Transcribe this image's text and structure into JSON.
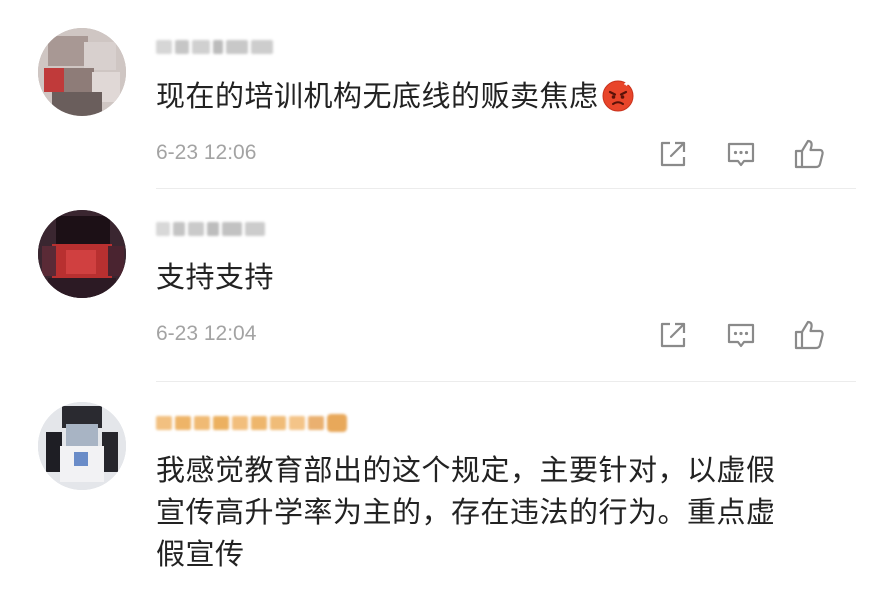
{
  "comments": [
    {
      "text": "现在的培训机构无底线的贩卖焦虑",
      "emoji": "angry-face-emoji",
      "time": "6-23 12:06",
      "username_color": "#c4c4c4"
    },
    {
      "text": "支持支持",
      "time": "6-23 12:04",
      "username_color": "#c4c4c4"
    },
    {
      "text_lines": [
        "我感觉教育部出的这个规定，主要针对，以虚假",
        "宣传高升学率为主的，存在违法的行为。重点虚",
        "假宣传"
      ],
      "username_color": "#f0b060"
    }
  ],
  "icons": {
    "share": "share-icon",
    "reply": "comment-icon",
    "like": "thumbs-up-icon"
  },
  "colors": {
    "text": "#222222",
    "timestamp": "#a3a3a3",
    "icon": "#8a8a8a",
    "divider": "#ececec",
    "emoji_red": "#e8452a"
  }
}
